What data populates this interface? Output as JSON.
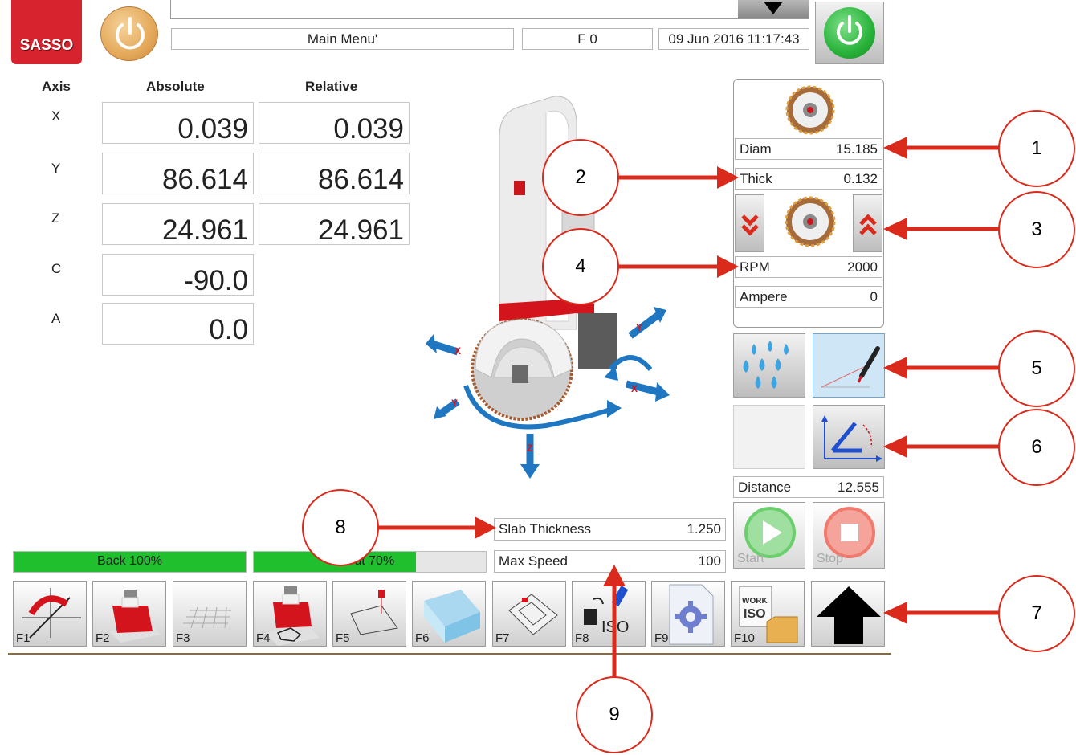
{
  "header": {
    "logo_text": "SASSO",
    "menu_title": "Main Menu'",
    "feed": "F 0",
    "datetime": "09 Jun 2016 11:17:43"
  },
  "axes_table": {
    "headers": {
      "axis": "Axis",
      "absolute": "Absolute",
      "relative": "Relative"
    },
    "rows": [
      {
        "axis": "X",
        "absolute": "0.039",
        "relative": "0.039"
      },
      {
        "axis": "Y",
        "absolute": "86.614",
        "relative": "86.614"
      },
      {
        "axis": "Z",
        "absolute": "24.961",
        "relative": "24.961"
      },
      {
        "axis": "C",
        "absolute": "-90.0",
        "relative": ""
      },
      {
        "axis": "A",
        "absolute": "0.0",
        "relative": ""
      }
    ]
  },
  "blade_panel": {
    "diam_label": "Diam",
    "diam_value": "15.185",
    "thick_label": "Thick",
    "thick_value": "0.132",
    "rpm_label": "RPM",
    "rpm_value": "2000",
    "ampere_label": "Ampere",
    "ampere_value": "0"
  },
  "distance": {
    "label": "Distance",
    "value": "12.555"
  },
  "slab": {
    "label": "Slab Thickness",
    "value": "1.250"
  },
  "max_speed": {
    "label": "Max Speed",
    "value": "100"
  },
  "progress": {
    "back": {
      "label": "Back 100%",
      "fraction": 1.0
    },
    "cut": {
      "label": "Cut 70%",
      "fraction": 0.7
    }
  },
  "start_label": "Start",
  "stop_label": "Stop",
  "function_keys": [
    "F1",
    "F2",
    "F3",
    "F4",
    "F5",
    "F6",
    "F7",
    "F8",
    "F9",
    "F10"
  ],
  "f8_text": "ISO",
  "f10_text": {
    "work": "WORK",
    "iso": "ISO"
  },
  "axis_arrow_letters": [
    "X",
    "Y",
    "Z",
    "X",
    "Y"
  ],
  "callouts": [
    "1",
    "2",
    "3",
    "4",
    "5",
    "6",
    "7",
    "8",
    "9"
  ],
  "colors": {
    "progress_green": "#1fbf2e",
    "callout_red": "#d92a1c",
    "arrow_blue": "#1f77c2",
    "machine_red": "#d4141c"
  }
}
